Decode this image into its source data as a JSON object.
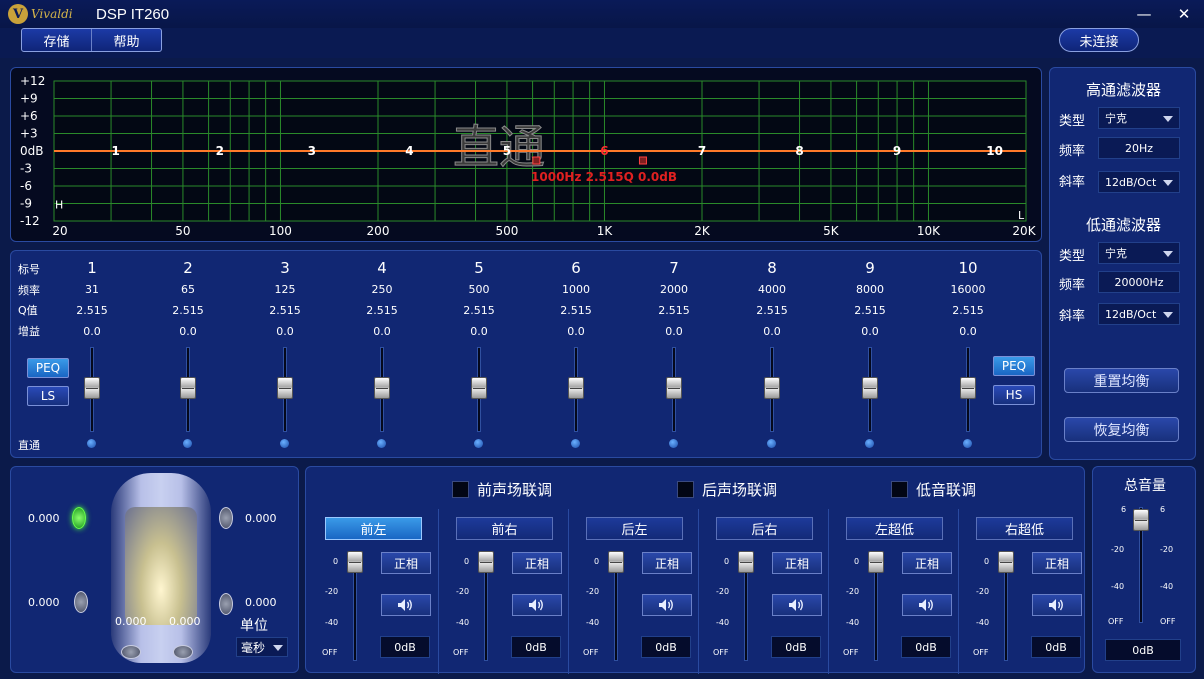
{
  "window": {
    "logo_text": "Vivaldi",
    "title": "DSP IT260",
    "minimize": "—",
    "close": "✕"
  },
  "menu": {
    "save": "存储",
    "help": "帮助",
    "connect": "未连接"
  },
  "graph": {
    "y_ticks": [
      "+12",
      "+9",
      "+6",
      "+3",
      "0dB",
      "-3",
      "-6",
      "-9",
      "-12"
    ],
    "x_ticks": [
      "20",
      "50",
      "100",
      "200",
      "500",
      "1K",
      "2K",
      "5K",
      "10K",
      "20K"
    ],
    "watermark": "直通",
    "readout": "1000Hz 2.515Q 0.0dB",
    "band_markers": [
      "1",
      "2",
      "3",
      "4",
      "5",
      "6",
      "7",
      "8",
      "9",
      "10"
    ],
    "hp_marker": "H",
    "lp_marker": "L",
    "colors": {
      "grid": "#2a8a2a",
      "curve": "#ff7a2a",
      "readout": "#e02020"
    }
  },
  "bands": {
    "row_labels": {
      "num": "标号",
      "freq": "频率",
      "q": "Q值",
      "gain": "增益",
      "bypass": "直通"
    },
    "items": [
      {
        "num": "1",
        "freq": "31",
        "q": "2.515",
        "gain": "0.0"
      },
      {
        "num": "2",
        "freq": "65",
        "q": "2.515",
        "gain": "0.0"
      },
      {
        "num": "3",
        "freq": "125",
        "q": "2.515",
        "gain": "0.0"
      },
      {
        "num": "4",
        "freq": "250",
        "q": "2.515",
        "gain": "0.0"
      },
      {
        "num": "5",
        "freq": "500",
        "q": "2.515",
        "gain": "0.0"
      },
      {
        "num": "6",
        "freq": "1000",
        "q": "2.515",
        "gain": "0.0"
      },
      {
        "num": "7",
        "freq": "2000",
        "q": "2.515",
        "gain": "0.0"
      },
      {
        "num": "8",
        "freq": "4000",
        "q": "2.515",
        "gain": "0.0"
      },
      {
        "num": "9",
        "freq": "8000",
        "q": "2.515",
        "gain": "0.0"
      },
      {
        "num": "10",
        "freq": "16000",
        "q": "2.515",
        "gain": "0.0"
      }
    ],
    "left_buttons": {
      "peq": "PEQ",
      "ls": "LS"
    },
    "right_buttons": {
      "peq": "PEQ",
      "hs": "HS"
    }
  },
  "highpass": {
    "title": "高通滤波器",
    "type_label": "类型",
    "type_value": "宁克",
    "freq_label": "频率",
    "freq_value": "20Hz",
    "slope_label": "斜率",
    "slope_value": "12dB/Oct"
  },
  "lowpass": {
    "title": "低通滤波器",
    "type_label": "类型",
    "type_value": "宁克",
    "freq_label": "频率",
    "freq_value": "20000Hz",
    "slope_label": "斜率",
    "slope_value": "12dB/Oct"
  },
  "eq_actions": {
    "reset": "重置均衡",
    "restore": "恢复均衡"
  },
  "car": {
    "delays": {
      "front_left": "0.000",
      "front_right": "0.000",
      "rear_left": "0.000",
      "rear_right": "0.000",
      "sub_left": "0.000",
      "sub_right": "0.000"
    },
    "unit_label": "单位",
    "unit_value": "毫秒"
  },
  "links": {
    "front": "前声场联调",
    "rear": "后声场联调",
    "bass": "低音联调"
  },
  "channels": {
    "scale": [
      "0",
      "-20",
      "-40",
      "OFF"
    ],
    "phase_label": "正相",
    "items": [
      {
        "name": "前左",
        "db": "0dB",
        "active": true
      },
      {
        "name": "前右",
        "db": "0dB",
        "active": false
      },
      {
        "name": "后左",
        "db": "0dB",
        "active": false
      },
      {
        "name": "后右",
        "db": "0dB",
        "active": false
      },
      {
        "name": "左超低",
        "db": "0dB",
        "active": false
      },
      {
        "name": "右超低",
        "db": "0dB",
        "active": false
      }
    ]
  },
  "master": {
    "title": "总音量",
    "scale": [
      "6",
      "-20",
      "-40",
      "OFF"
    ],
    "db": "0dB"
  }
}
